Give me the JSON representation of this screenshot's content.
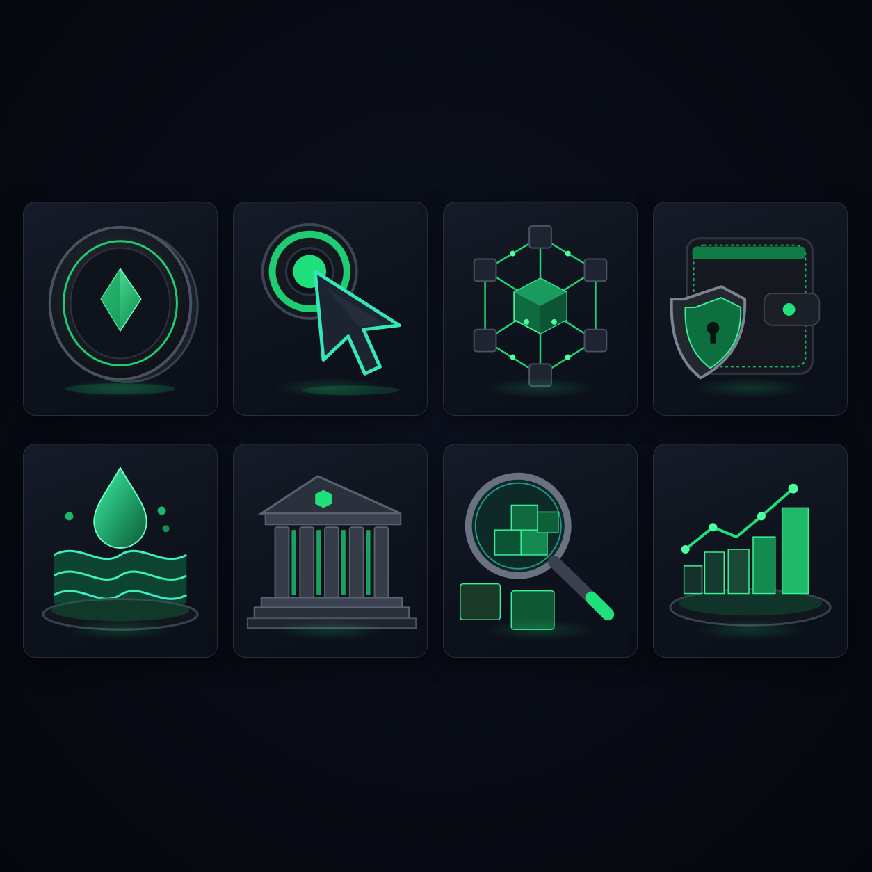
{
  "icons": [
    {
      "name": "coin-icon"
    },
    {
      "name": "cursor-click-icon"
    },
    {
      "name": "blockchain-network-icon"
    },
    {
      "name": "wallet-shield-icon"
    },
    {
      "name": "liquidity-drop-icon"
    },
    {
      "name": "bank-building-icon"
    },
    {
      "name": "block-search-icon"
    },
    {
      "name": "growth-chart-icon"
    }
  ],
  "colors": {
    "background": "#080b14",
    "tile": "#111722",
    "accent": "#1fe07a",
    "accent_dark": "#0e7a44",
    "metal": "#3a4150"
  }
}
